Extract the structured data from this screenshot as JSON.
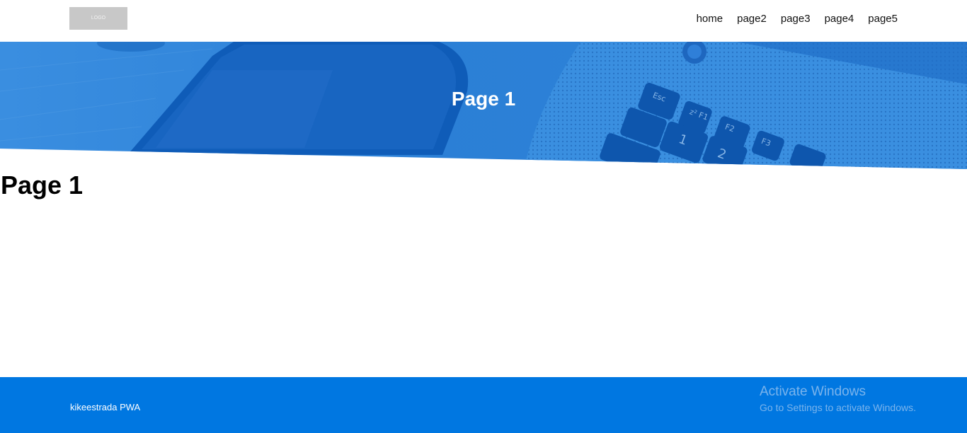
{
  "header": {
    "logo_text": "LOGO",
    "nav": [
      "home",
      "page2",
      "page3",
      "page4",
      "page5"
    ]
  },
  "hero": {
    "title": "Page 1"
  },
  "main": {
    "heading": "Page 1"
  },
  "footer": {
    "brand": "kikeestrada PWA"
  },
  "watermark": {
    "title": "Activate Windows",
    "subtitle": "Go to Settings to activate Windows."
  },
  "colors": {
    "hero_blue": "#2b7fd6",
    "footer_blue": "#0077e1"
  }
}
